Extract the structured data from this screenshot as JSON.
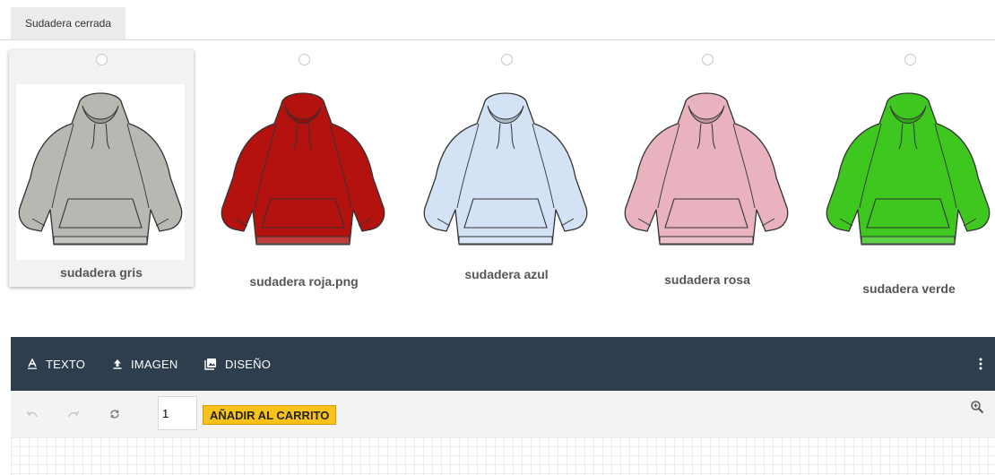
{
  "tab": {
    "label": "Sudadera cerrada"
  },
  "options": [
    {
      "label": "sudadera gris",
      "color": "#b8b8b2",
      "selected": true
    },
    {
      "label": "sudadera roja.png",
      "color": "#b3120e",
      "selected": false
    },
    {
      "label": "sudadera azul",
      "color": "#d3e2f4",
      "selected": false
    },
    {
      "label": "sudadera rosa",
      "color": "#e8b3bf",
      "selected": false
    },
    {
      "label": "sudadera verde",
      "color": "#3ec81f",
      "selected": false
    }
  ],
  "toolbar": {
    "text_label": "TEXTO",
    "image_label": "IMAGEN",
    "design_label": "DISEÑO",
    "background": "#2e3e4e"
  },
  "actions": {
    "undo_icon": "undo-icon",
    "redo_icon": "redo-icon",
    "reset_icon": "refresh-icon",
    "quantity": "1",
    "add_to_cart_label": "AÑADIR AL CARRITO",
    "cart_color": "#f9c21b",
    "zoom_icon": "zoom-in-icon"
  }
}
